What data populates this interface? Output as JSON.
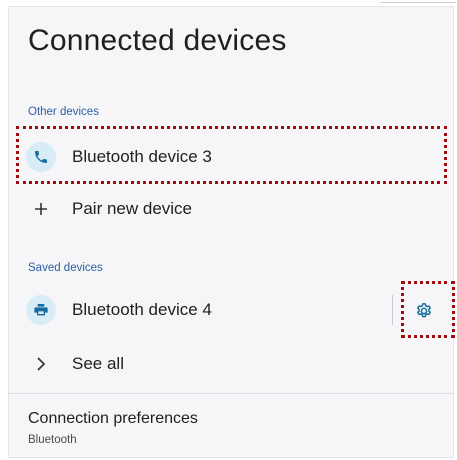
{
  "page": {
    "title": "Connected devices"
  },
  "other_devices": {
    "header": "Other devices",
    "items": [
      {
        "label": "Bluetooth device 3",
        "icon": "phone-icon"
      }
    ],
    "pair_new": {
      "label": "Pair new device",
      "icon": "plus-icon"
    }
  },
  "saved_devices": {
    "header": "Saved devices",
    "items": [
      {
        "label": "Bluetooth device 4",
        "icon": "printer-icon",
        "settings_icon": "gear-icon"
      }
    ],
    "see_all": {
      "label": "See all",
      "icon": "chevron-right-icon"
    }
  },
  "preferences": {
    "title": "Connection preferences",
    "subtitle": "Bluetooth"
  },
  "colors": {
    "accent": "#2b5fa8",
    "icon_bg": "#d7ecf7",
    "icon_fg": "#1a6e9e",
    "highlight": "#a00c0c",
    "background": "#f6f6f8"
  }
}
